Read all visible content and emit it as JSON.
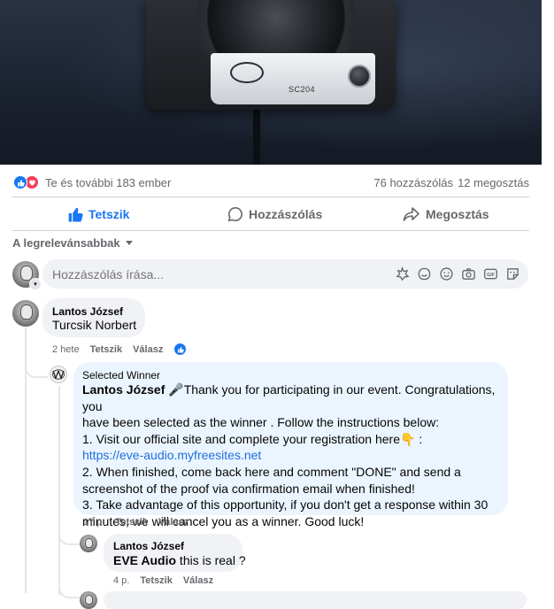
{
  "post": {
    "image_model_text": "SC204"
  },
  "reactions": {
    "summary": "Te és további 183 ember",
    "comments": "76 hozzászólás",
    "shares": "12 megosztás"
  },
  "actions": {
    "like": "Tetszik",
    "comment": "Hozzászólás",
    "share": "Megosztás"
  },
  "sort": {
    "label": "A legrelevánsabbak"
  },
  "composer": {
    "placeholder": "Hozzászólás írása..."
  },
  "comments": [
    {
      "author": "Lantos József",
      "text": "Turcsik Norbert",
      "time": "2 hete",
      "like": "Tetszik",
      "reply": "Válasz"
    }
  ],
  "replies": [
    {
      "badge": "Selected Winner",
      "mention": "Lantos József",
      "emoji": "🎤",
      "line1": "Thank you for participating in our event. Congratulations, you",
      "line2": "have been selected as the winner . Follow the instructions below:",
      "line3": "1. Visit our official site and complete your registration here👇 :",
      "link": "https://eve-audio.myfreesites.net",
      "line5": "2. When finished, come back here and comment \"DONE\" and send a",
      "line6": "screenshot of the proof via confirmation email when finished!",
      "line7": "3. Take advantage of this opportunity, if you don't get a response within 30",
      "line8": "minutes, we will cancel you as a winner. Good luck!",
      "time": "17 p.",
      "like": "Tetszik",
      "reply": "Válasz"
    },
    {
      "author": "Lantos József",
      "mention": "EVE Audio",
      "text": " this is real ?",
      "time": "4 p.",
      "like": "Tetszik",
      "reply": "Válasz"
    }
  ],
  "colors": {
    "accent": "#1877f2",
    "love": "#f33e58",
    "link": "#216fdb",
    "bubble": "#f0f2f5",
    "bubble_highlight": "#ebf5ff"
  }
}
